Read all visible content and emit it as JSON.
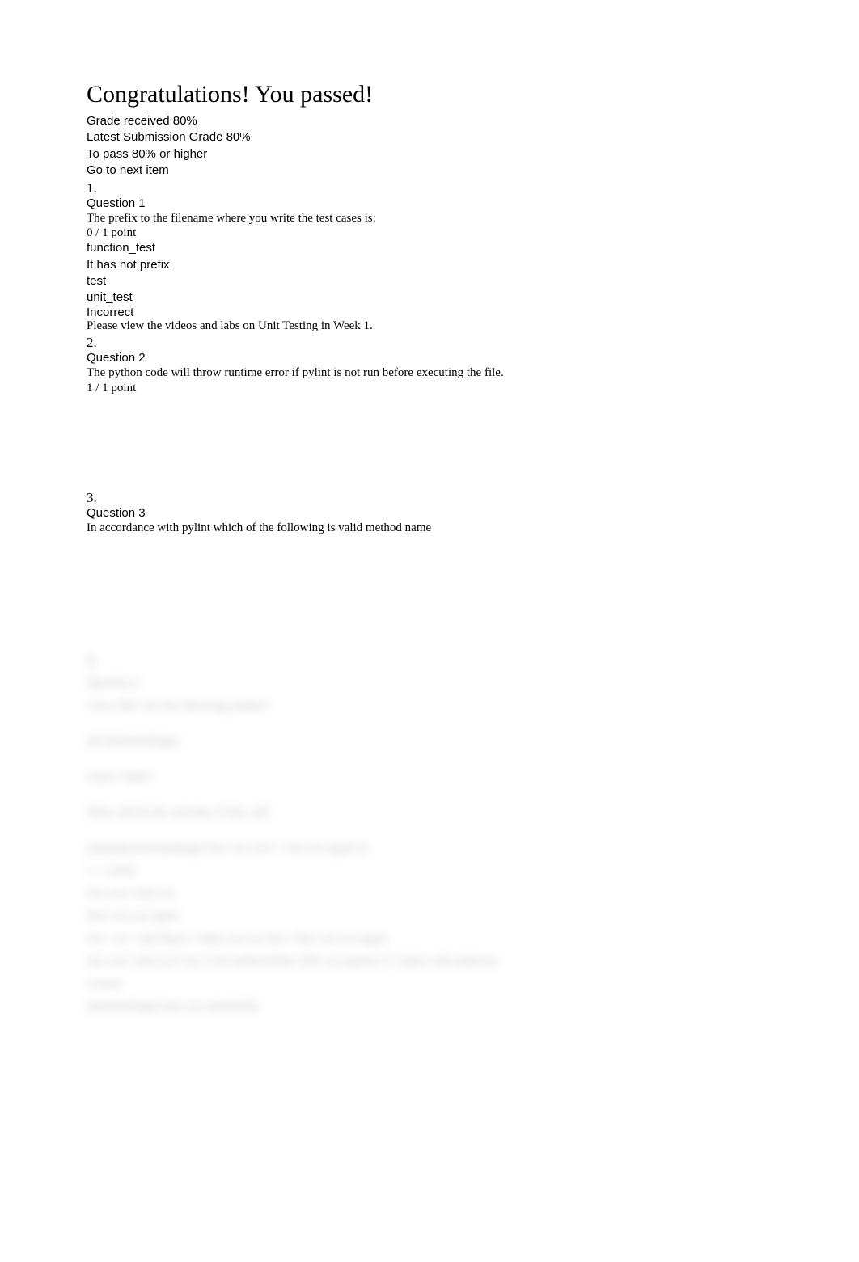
{
  "header": {
    "title": "Congratulations! You passed!",
    "grade_label": "Grade received",
    "grade_value": "80%",
    "latest_label": "Latest Submission Grade",
    "latest_value": "80%",
    "pass_label": "To pass",
    "pass_value": "80% or higher",
    "next_link": "Go to next item"
  },
  "q1": {
    "num": "1.",
    "label": "Question 1",
    "text": "The prefix to the filename where you write the test cases is:",
    "points": "0 / 1 point",
    "options": [
      "function_test",
      "It has not prefix",
      "test",
      "unit_test"
    ],
    "feedback_label": "Incorrect",
    "feedback_text": "Please view the videos and labs on Unit Testing in Week 1."
  },
  "q2": {
    "num": "2.",
    "label": "Question 2",
    "text": "The python code will throw runtime error if pylint is not run before executing the file.",
    "points": "1 / 1 point"
  },
  "q3": {
    "num": "3.",
    "label": "Question 3",
    "text": "In accordance with pylint which of the following is valid method name"
  },
  "q4": {
    "num": "4.",
    "label": "Question 4",
    "line1": "Class ABC has the following method",
    "line2": "def doSomething():",
    "line3": "return \"Hello\"",
    "line4": "What will be the outcome of this call?",
    "line5": "print(obj.doSomething(\"How are you?\",\"See you again\"))",
    "opt1": "1 / 1 point",
    "opt2": "See you? And you",
    "opt3": "How are you again",
    "opt4": "See / An / said Marie / Hello you see this / How are you again",
    "opt5": "See you? said you? See 2150 unified Hello 2001 are against 6-7 taken with unknown",
    "feedback_label": "Correct",
    "feedback_text": "doSomething() may not remarkable"
  }
}
